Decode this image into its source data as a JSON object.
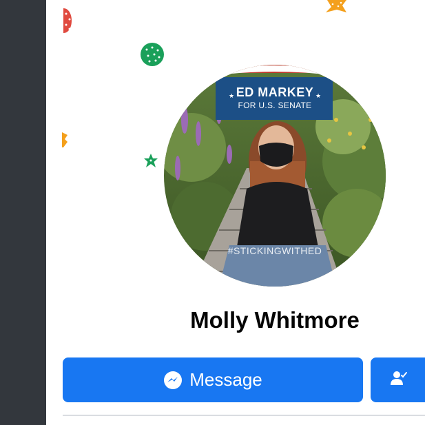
{
  "profile": {
    "name": "Molly Whitmore"
  },
  "avatar": {
    "banner_title": "ED MARKEY",
    "banner_subtitle": "FOR U.S. SENATE",
    "hashtag": "#STICKINGWITHED",
    "frame_colors": {
      "banner_blue": "#1c4f86",
      "stripe_red": "#c0392b"
    }
  },
  "actions": {
    "message_label": "Message",
    "message_icon": "messenger-icon",
    "friend_icon": "person-check-icon"
  },
  "colors": {
    "accent": "#1877f2",
    "sidebar": "#33373d",
    "confetti": [
      "#e04040",
      "#1aa05a",
      "#f4a01c"
    ]
  }
}
